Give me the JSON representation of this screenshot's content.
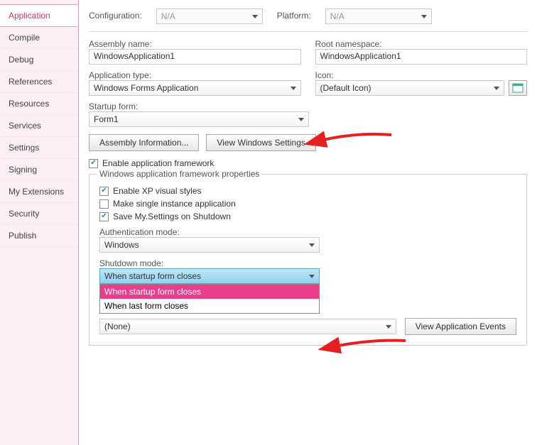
{
  "sidebar": {
    "items": [
      {
        "label": "Application"
      },
      {
        "label": "Compile"
      },
      {
        "label": "Debug"
      },
      {
        "label": "References"
      },
      {
        "label": "Resources"
      },
      {
        "label": "Services"
      },
      {
        "label": "Settings"
      },
      {
        "label": "Signing"
      },
      {
        "label": "My Extensions"
      },
      {
        "label": "Security"
      },
      {
        "label": "Publish"
      }
    ]
  },
  "top": {
    "config_label": "Configuration:",
    "config_value": "N/A",
    "platform_label": "Platform:",
    "platform_value": "N/A"
  },
  "assembly": {
    "name_label": "Assembly name:",
    "name_value": "WindowsApplication1",
    "root_label": "Root namespace:",
    "root_value": "WindowsApplication1"
  },
  "apptype": {
    "type_label": "Application type:",
    "type_value": "Windows Forms Application",
    "icon_label": "Icon:",
    "icon_value": "(Default Icon)"
  },
  "startup": {
    "label": "Startup form:",
    "value": "Form1"
  },
  "buttons": {
    "assembly_info": "Assembly Information...",
    "view_settings": "View Windows Settings"
  },
  "enable_framework": "Enable application framework",
  "framework": {
    "title": "Windows application framework properties",
    "xp": "Enable XP visual styles",
    "single": "Make single instance application",
    "save": "Save My.Settings on Shutdown",
    "auth_label": "Authentication mode:",
    "auth_value": "Windows",
    "shutdown_label": "Shutdown mode:",
    "shutdown_value": "When startup form closes",
    "shutdown_opt1": "When startup form closes",
    "shutdown_opt2": "When last form closes",
    "none_value": "(None)",
    "view_events": "View Application Events"
  }
}
